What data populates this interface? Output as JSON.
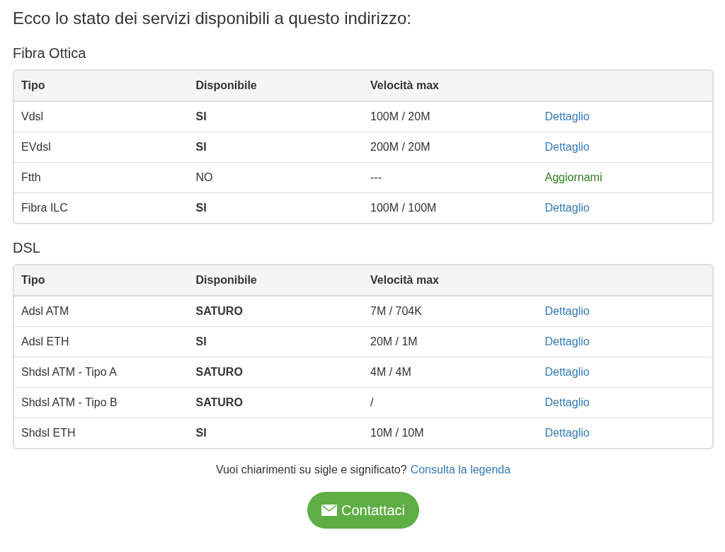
{
  "heading": "Ecco lo stato dei servizi disponibili a questo indirizzo:",
  "sections": [
    {
      "title": "Fibra Ottica",
      "columns": [
        "Tipo",
        "Disponibile",
        "Velocità max"
      ],
      "rows": [
        {
          "type": "Vdsl",
          "available": "SI",
          "emphasis": true,
          "speed": "100M / 20M",
          "action": {
            "label": "Dettaglio",
            "kind": "detail"
          }
        },
        {
          "type": "EVdsl",
          "available": "SI",
          "emphasis": true,
          "speed": "200M / 20M",
          "action": {
            "label": "Dettaglio",
            "kind": "detail"
          }
        },
        {
          "type": "Ftth",
          "available": "NO",
          "emphasis": false,
          "speed": "---",
          "action": {
            "label": "Aggiornami",
            "kind": "notify"
          }
        },
        {
          "type": "Fibra ILC",
          "available": "SI",
          "emphasis": true,
          "speed": "100M / 100M",
          "action": {
            "label": "Dettaglio",
            "kind": "detail"
          }
        }
      ]
    },
    {
      "title": "DSL",
      "columns": [
        "Tipo",
        "Disponibile",
        "Velocità max"
      ],
      "rows": [
        {
          "type": "Adsl ATM",
          "available": "SATURO",
          "emphasis": true,
          "speed": "7M / 704K",
          "action": {
            "label": "Dettaglio",
            "kind": "detail"
          }
        },
        {
          "type": "Adsl ETH",
          "available": "SI",
          "emphasis": true,
          "speed": "20M / 1M",
          "action": {
            "label": "Dettaglio",
            "kind": "detail"
          }
        },
        {
          "type": "Shdsl ATM - Tipo A",
          "available": "SATURO",
          "emphasis": true,
          "speed": "4M / 4M",
          "action": {
            "label": "Dettaglio",
            "kind": "detail"
          }
        },
        {
          "type": "Shdsl ATM - Tipo B",
          "available": "SATURO",
          "emphasis": true,
          "speed": "/",
          "action": {
            "label": "Dettaglio",
            "kind": "detail"
          }
        },
        {
          "type": "Shdsl ETH",
          "available": "SI",
          "emphasis": true,
          "speed": "10M / 10M",
          "action": {
            "label": "Dettaglio",
            "kind": "detail"
          }
        }
      ]
    }
  ],
  "legend": {
    "question": "Vuoi chiarimenti su sigle e significato?",
    "link": "Consulta la legenda"
  },
  "contact_button": "Contattaci"
}
